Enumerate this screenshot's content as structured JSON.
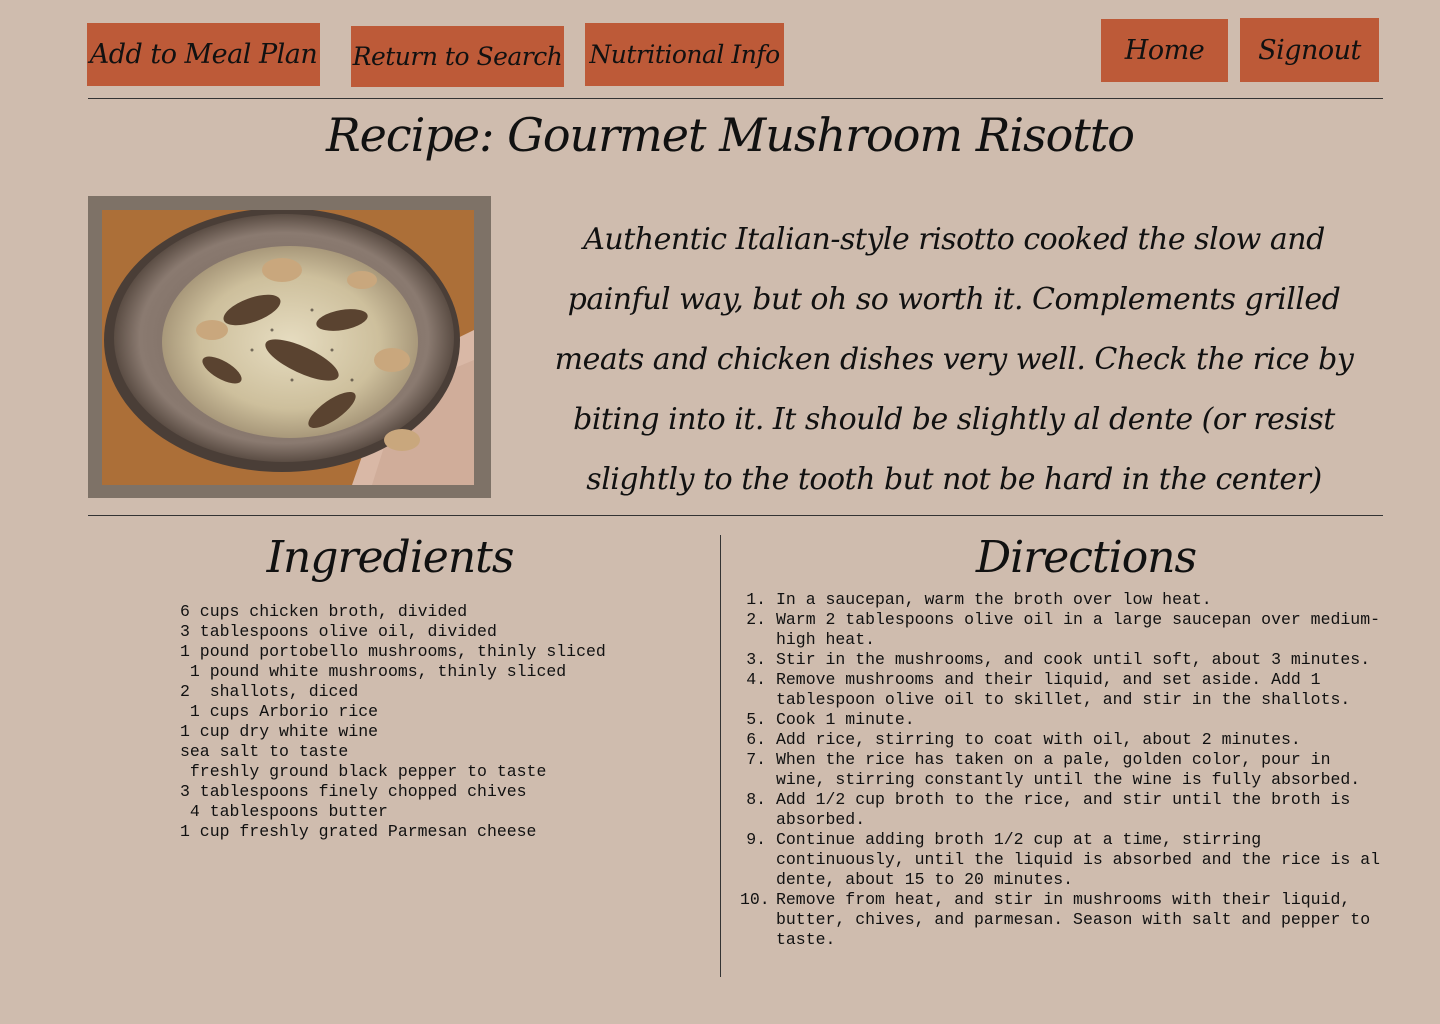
{
  "nav": {
    "add_to_meal_plan": "Add to Meal Plan",
    "return_to_search": "Return to Search",
    "nutritional_info": "Nutritional Info",
    "home": "Home",
    "signout": "Signout"
  },
  "colors": {
    "background": "#cfbcae",
    "button": "#bd5a38",
    "photo_frame": "#7e7267"
  },
  "recipe": {
    "title": "Recipe: Gourmet Mushroom Risotto",
    "description": "Authentic Italian-style risotto cooked the slow and painful way, but oh so worth it. Complements grilled meats and chicken dishes very well.  Check the rice by biting into it. It should be slightly al dente (or resist slightly to the tooth but not be hard in the center)",
    "ingredients_heading": "Ingredients",
    "directions_heading": "Directions",
    "ingredients": [
      "6 cups chicken broth, divided",
      "3 tablespoons olive oil, divided",
      "1 pound portobello mushrooms, thinly sliced",
      " 1 pound white mushrooms, thinly sliced",
      "2  shallots, diced",
      " 1 cups Arborio rice",
      "1 cup dry white wine",
      "sea salt to taste",
      " freshly ground black pepper to taste",
      "3 tablespoons finely chopped chives",
      " 4 tablespoons butter",
      "1 cup freshly grated Parmesan cheese"
    ],
    "directions": [
      {
        "num": "1.",
        "text": "In a saucepan, warm the broth over low heat."
      },
      {
        "num": "2.",
        "text": "Warm 2 tablespoons olive oil in a large saucepan over medium-high heat."
      },
      {
        "num": "3.",
        "text": "Stir in the mushrooms, and cook until soft, about 3 minutes."
      },
      {
        "num": "4.",
        "text": "Remove mushrooms and their liquid, and set aside. Add 1 tablespoon olive oil to skillet,  and stir in the shallots."
      },
      {
        "num": "5.",
        "text": "Cook 1 minute."
      },
      {
        "num": "6.",
        "text": "Add rice, stirring to coat with oil, about 2 minutes."
      },
      {
        "num": "7.",
        "text": "When the rice has taken on a pale, golden color, pour in wine, stirring constantly until the wine is fully absorbed."
      },
      {
        "num": "8.",
        "text": "Add 1/2 cup broth to the rice, and stir until the broth is absorbed."
      },
      {
        "num": "9.",
        "text": "Continue adding broth 1/2 cup at a time, stirring continuously, until the liquid is absorbed and the rice is al dente, about 15 to 20 minutes."
      },
      {
        "num": "10.",
        "text": "Remove from heat, and stir in mushrooms with their liquid, butter, chives, and parmesan. Season with salt and pepper to taste."
      }
    ]
  }
}
